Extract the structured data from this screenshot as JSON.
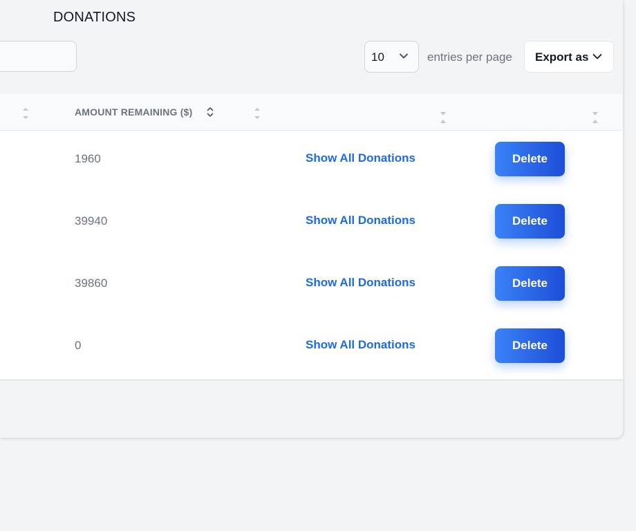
{
  "header": {
    "title": "DONATIONS"
  },
  "search": {
    "value": "",
    "placeholder": ""
  },
  "pagination": {
    "entries_value": "10",
    "entries_label": "entries per page"
  },
  "toolbar": {
    "export_label": "Export as"
  },
  "table": {
    "columns": [
      {
        "label": ""
      },
      {
        "label": "AMOUNT REMAINING ($)"
      },
      {
        "label": ""
      },
      {
        "label": ""
      }
    ],
    "rows": [
      {
        "amount_remaining": "1960",
        "link_label": "Show All Donations",
        "delete_label": "Delete"
      },
      {
        "amount_remaining": "39940",
        "link_label": "Show All Donations",
        "delete_label": "Delete"
      },
      {
        "amount_remaining": "39860",
        "link_label": "Show All Donations",
        "delete_label": "Delete"
      },
      {
        "amount_remaining": "0",
        "link_label": "Show All Donations",
        "delete_label": "Delete"
      }
    ]
  },
  "colors": {
    "link": "#1d6ae5",
    "button_start": "#3b82f6",
    "button_end": "#1d4ed8",
    "muted_text": "#6b7280"
  },
  "icons": {
    "dropdown": "chevron-down-icon",
    "sort": "sort-icon"
  }
}
